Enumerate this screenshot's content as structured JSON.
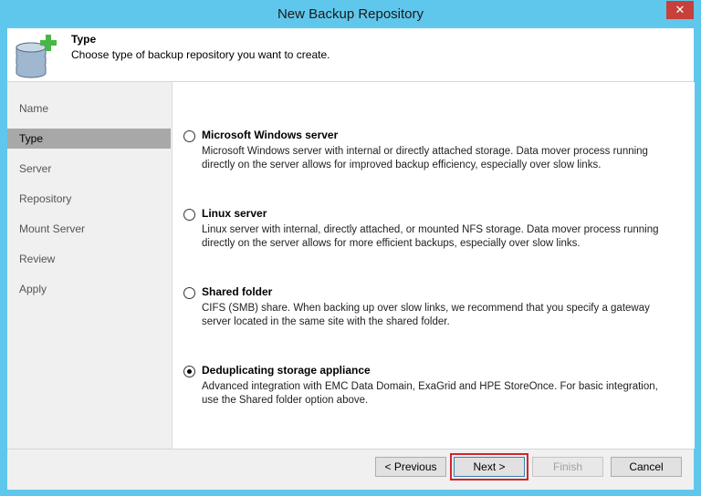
{
  "window": {
    "title": "New Backup Repository",
    "close_glyph": "✕"
  },
  "header": {
    "title": "Type",
    "subtitle": "Choose type of backup repository you want to create."
  },
  "sidebar": {
    "items": [
      {
        "label": "Name",
        "active": false
      },
      {
        "label": "Type",
        "active": true
      },
      {
        "label": "Server",
        "active": false
      },
      {
        "label": "Repository",
        "active": false
      },
      {
        "label": "Mount Server",
        "active": false
      },
      {
        "label": "Review",
        "active": false
      },
      {
        "label": "Apply",
        "active": false
      }
    ]
  },
  "options": [
    {
      "title": "Microsoft Windows server",
      "description": "Microsoft Windows server with internal or directly attached storage. Data mover process running directly on the server allows for improved backup efficiency, especially over slow links.",
      "selected": false
    },
    {
      "title": "Linux server",
      "description": "Linux server with internal, directly attached, or mounted NFS storage. Data mover process running directly on the server allows for more efficient backups, especially over slow links.",
      "selected": false
    },
    {
      "title": "Shared folder",
      "description": "CIFS (SMB) share. When backing up over slow links, we recommend that you specify a gateway server located in the same site with the shared folder.",
      "selected": false
    },
    {
      "title": "Deduplicating storage appliance",
      "description": "Advanced integration with EMC Data Domain, ExaGrid and HPE StoreOnce. For basic integration, use the Shared folder option above.",
      "selected": true
    }
  ],
  "buttons": {
    "previous": "< Previous",
    "next": "Next >",
    "finish": "Finish",
    "cancel": "Cancel"
  },
  "colors": {
    "title_bar": "#60c7ec",
    "close_button": "#c7403a",
    "active_nav": "#a8a8a8",
    "highlight": "#d0262b"
  }
}
